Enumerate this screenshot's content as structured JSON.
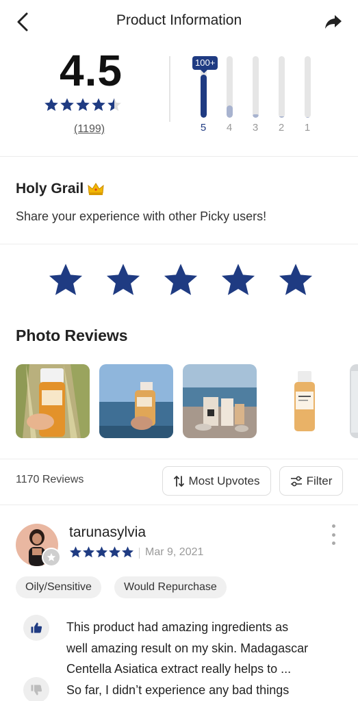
{
  "header": {
    "title": "Product Information",
    "back_icon": "chevron-left-icon",
    "share_icon": "share-arrow-icon"
  },
  "rating_summary": {
    "average": "4.5",
    "average_stars": 4.5,
    "review_count": "(1199)",
    "distribution": [
      {
        "label": "5",
        "fill": 1.0,
        "badge": "100+"
      },
      {
        "label": "4",
        "fill": 0.2
      },
      {
        "label": "3",
        "fill": 0.05
      },
      {
        "label": "2",
        "fill": 0.0
      },
      {
        "label": "1",
        "fill": 0.0
      }
    ]
  },
  "holy_grail": {
    "title": "Holy Grail",
    "icon": "crown-icon",
    "subtitle": "Share your experience with other Picky users!"
  },
  "rate_stars": 5,
  "photo_reviews": {
    "title": "Photo Reviews",
    "photos": [
      "photo-1",
      "photo-2",
      "photo-3",
      "photo-4",
      "photo-5"
    ]
  },
  "reviews_bar": {
    "count": "1170 Reviews",
    "sort_label": "Most Upvotes",
    "filter_label": "Filter"
  },
  "review": {
    "username": "tarunasylvia",
    "stars": 5,
    "date": "Mar 9, 2021",
    "tags": [
      "Oily/Sensitive",
      "Would Repurchase"
    ],
    "text_lines": [
      "This product had amazing ingredients as",
      "well amazing result on my skin. Madagascar",
      "Centella Asiatica extract really helps to ...",
      "So far, I didn’t experience any bad things"
    ]
  },
  "colors": {
    "accent": "#1f3b82",
    "divider": "#ececec",
    "chip_bg": "#f0f0f0"
  }
}
